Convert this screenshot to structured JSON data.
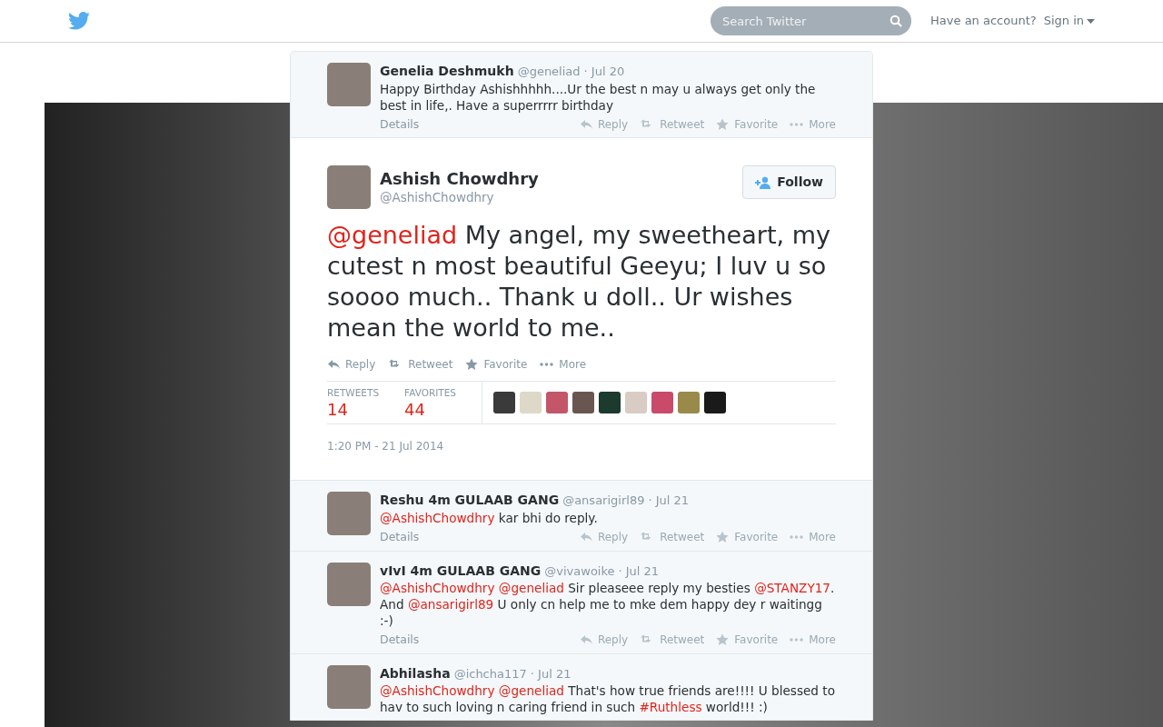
{
  "header": {
    "search": {
      "placeholder": "Search Twitter"
    },
    "account_prompt": "Have an account?",
    "sign_in": "Sign in"
  },
  "parent_tweet": {
    "name": "Genelia Deshmukh",
    "handle": "@geneliad",
    "date": "· Jul 20",
    "text": [
      {
        "kind": "text",
        "text": "Happy Birthday Ashishhhhh....Ur the best n may u always get only the best in life,. Have a superrrrr birthday"
      }
    ],
    "details": "Details",
    "actions": [
      {
        "kind": "reply",
        "label": "Reply"
      },
      {
        "kind": "retweet",
        "label": "Retweet"
      },
      {
        "kind": "favorite",
        "label": "Favorite"
      },
      {
        "kind": "more",
        "label": "More"
      }
    ]
  },
  "main_tweet": {
    "name": "Ashish Chowdhry",
    "handle": "@AshishChowdhry",
    "follow": "Follow",
    "text": [
      {
        "kind": "mention",
        "text": "@geneliad"
      },
      {
        "kind": "text",
        "text": " My angel, my sweetheart, my cutest n most beautiful Geeyu; I luv u so soooo much.. Thank u doll.. Ur wishes mean the world to me.."
      }
    ],
    "actions": [
      {
        "kind": "reply",
        "label": "Reply"
      },
      {
        "kind": "retweet",
        "label": "Retweet"
      },
      {
        "kind": "favorite",
        "label": "Favorite"
      },
      {
        "kind": "more",
        "label": "More"
      }
    ],
    "stats": [
      {
        "label": "RETWEETS",
        "value": "14"
      },
      {
        "label": "FAVORITES",
        "value": "44"
      }
    ],
    "timestamp": "1:20 PM - 21 Jul 2014"
  },
  "replies": [
    {
      "name": "Reshu 4m GULAAB GANG",
      "handle": "@ansarigirl89",
      "date": "· Jul 21",
      "text": [
        {
          "kind": "mention",
          "text": "@AshishChowdhry"
        },
        {
          "kind": "text",
          "text": " kar bhi do reply."
        }
      ],
      "details": "Details",
      "actions": [
        {
          "kind": "reply",
          "label": "Reply"
        },
        {
          "kind": "retweet",
          "label": "Retweet"
        },
        {
          "kind": "favorite",
          "label": "Favorite"
        },
        {
          "kind": "more",
          "label": "More"
        }
      ]
    },
    {
      "name": "vIvI 4m GULAAB GANG",
      "handle": "@vivawoike",
      "date": "· Jul 21",
      "text": [
        {
          "kind": "mention",
          "text": "@AshishChowdhry"
        },
        {
          "kind": "mention",
          "text": "@geneliad"
        },
        {
          "kind": "text",
          "text": " Sir pleaseee reply my besties "
        },
        {
          "kind": "mention",
          "text": "@STANZY17"
        },
        {
          "kind": "text",
          "text": ". And "
        },
        {
          "kind": "mention",
          "text": "@ansarigirl89"
        },
        {
          "kind": "text",
          "text": " U only cn help me to mke dem happy dey r waitingg :-)"
        }
      ],
      "details": "Details",
      "actions": [
        {
          "kind": "reply",
          "label": "Reply"
        },
        {
          "kind": "retweet",
          "label": "Retweet"
        },
        {
          "kind": "favorite",
          "label": "Favorite"
        },
        {
          "kind": "more",
          "label": "More"
        }
      ]
    },
    {
      "name": "Abhilasha",
      "handle": "@ichcha117",
      "date": "· Jul 21",
      "text": [
        {
          "kind": "mention",
          "text": "@AshishChowdhry"
        },
        {
          "kind": "mention",
          "text": "@geneliad"
        },
        {
          "kind": "text",
          "text": " That's how true friends are!!!! U blessed to hav to such loving n caring friend in such "
        },
        {
          "kind": "hashtag",
          "text": "#Ruthless"
        },
        {
          "kind": "text",
          "text": " world!!! :)"
        }
      ]
    }
  ]
}
